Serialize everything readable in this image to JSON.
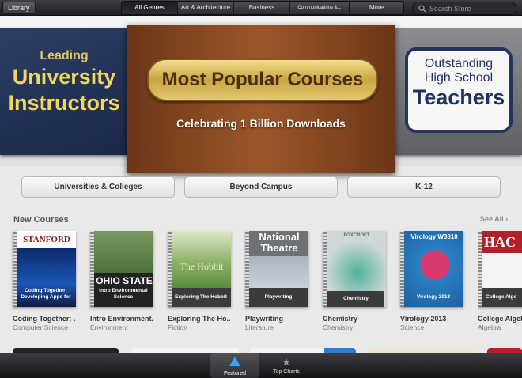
{
  "topbar": {
    "library_label": "Library",
    "tabs": [
      {
        "label": "All Genres",
        "active": true
      },
      {
        "label": "Art & Architecture",
        "active": false
      },
      {
        "label": "Business",
        "active": false
      },
      {
        "label": "Communications &...",
        "active": false
      },
      {
        "label": "More",
        "active": false
      }
    ],
    "search_placeholder": "Search Store"
  },
  "banner": {
    "left": {
      "line1": "Leading",
      "line2": "University",
      "line3": "Instructors"
    },
    "center": {
      "plaque": "Most Popular Courses",
      "subtitle": "Celebrating 1 Billion Downloads"
    },
    "right": {
      "line1": "Outstanding",
      "line2": "High School",
      "line3": "Teachers"
    }
  },
  "categories": [
    "Universities & Colleges",
    "Beyond Campus",
    "K-12"
  ],
  "new_courses": {
    "title": "New Courses",
    "see_all": "See All",
    "items": [
      {
        "name": "Coding Together: ...",
        "category": "Computer Science",
        "cover_head": "STANFORD",
        "cover_title": "Coding Together: Developing Apps for"
      },
      {
        "name": "Intro Environment...",
        "category": "Environment",
        "cover_head": "OHIO STATE",
        "cover_title": "Intro Environmental Science"
      },
      {
        "name": "Exploring The Ho...",
        "category": "Fiction",
        "cover_head": "The Hobbit",
        "cover_title": "Exploring The Hobbit"
      },
      {
        "name": "Playwriting",
        "category": "Literature",
        "cover_head": "National Theatre",
        "cover_title": "Playwriting"
      },
      {
        "name": "Chemistry",
        "category": "Chemistry",
        "cover_head": "FOXCROFT",
        "cover_title": "Chemistry"
      },
      {
        "name": "Virology 2013",
        "category": "Science",
        "cover_head": "Virology W3310",
        "cover_title": "Virology 2013"
      },
      {
        "name": "College Algeb",
        "category": "Algebra",
        "cover_head": "HAC",
        "cover_title": "College Alge"
      }
    ]
  },
  "tabbar": [
    {
      "label": "Featured",
      "icon": "featured-icon",
      "selected": true
    },
    {
      "label": "Top Charts",
      "icon": "star-icon",
      "selected": false
    }
  ]
}
